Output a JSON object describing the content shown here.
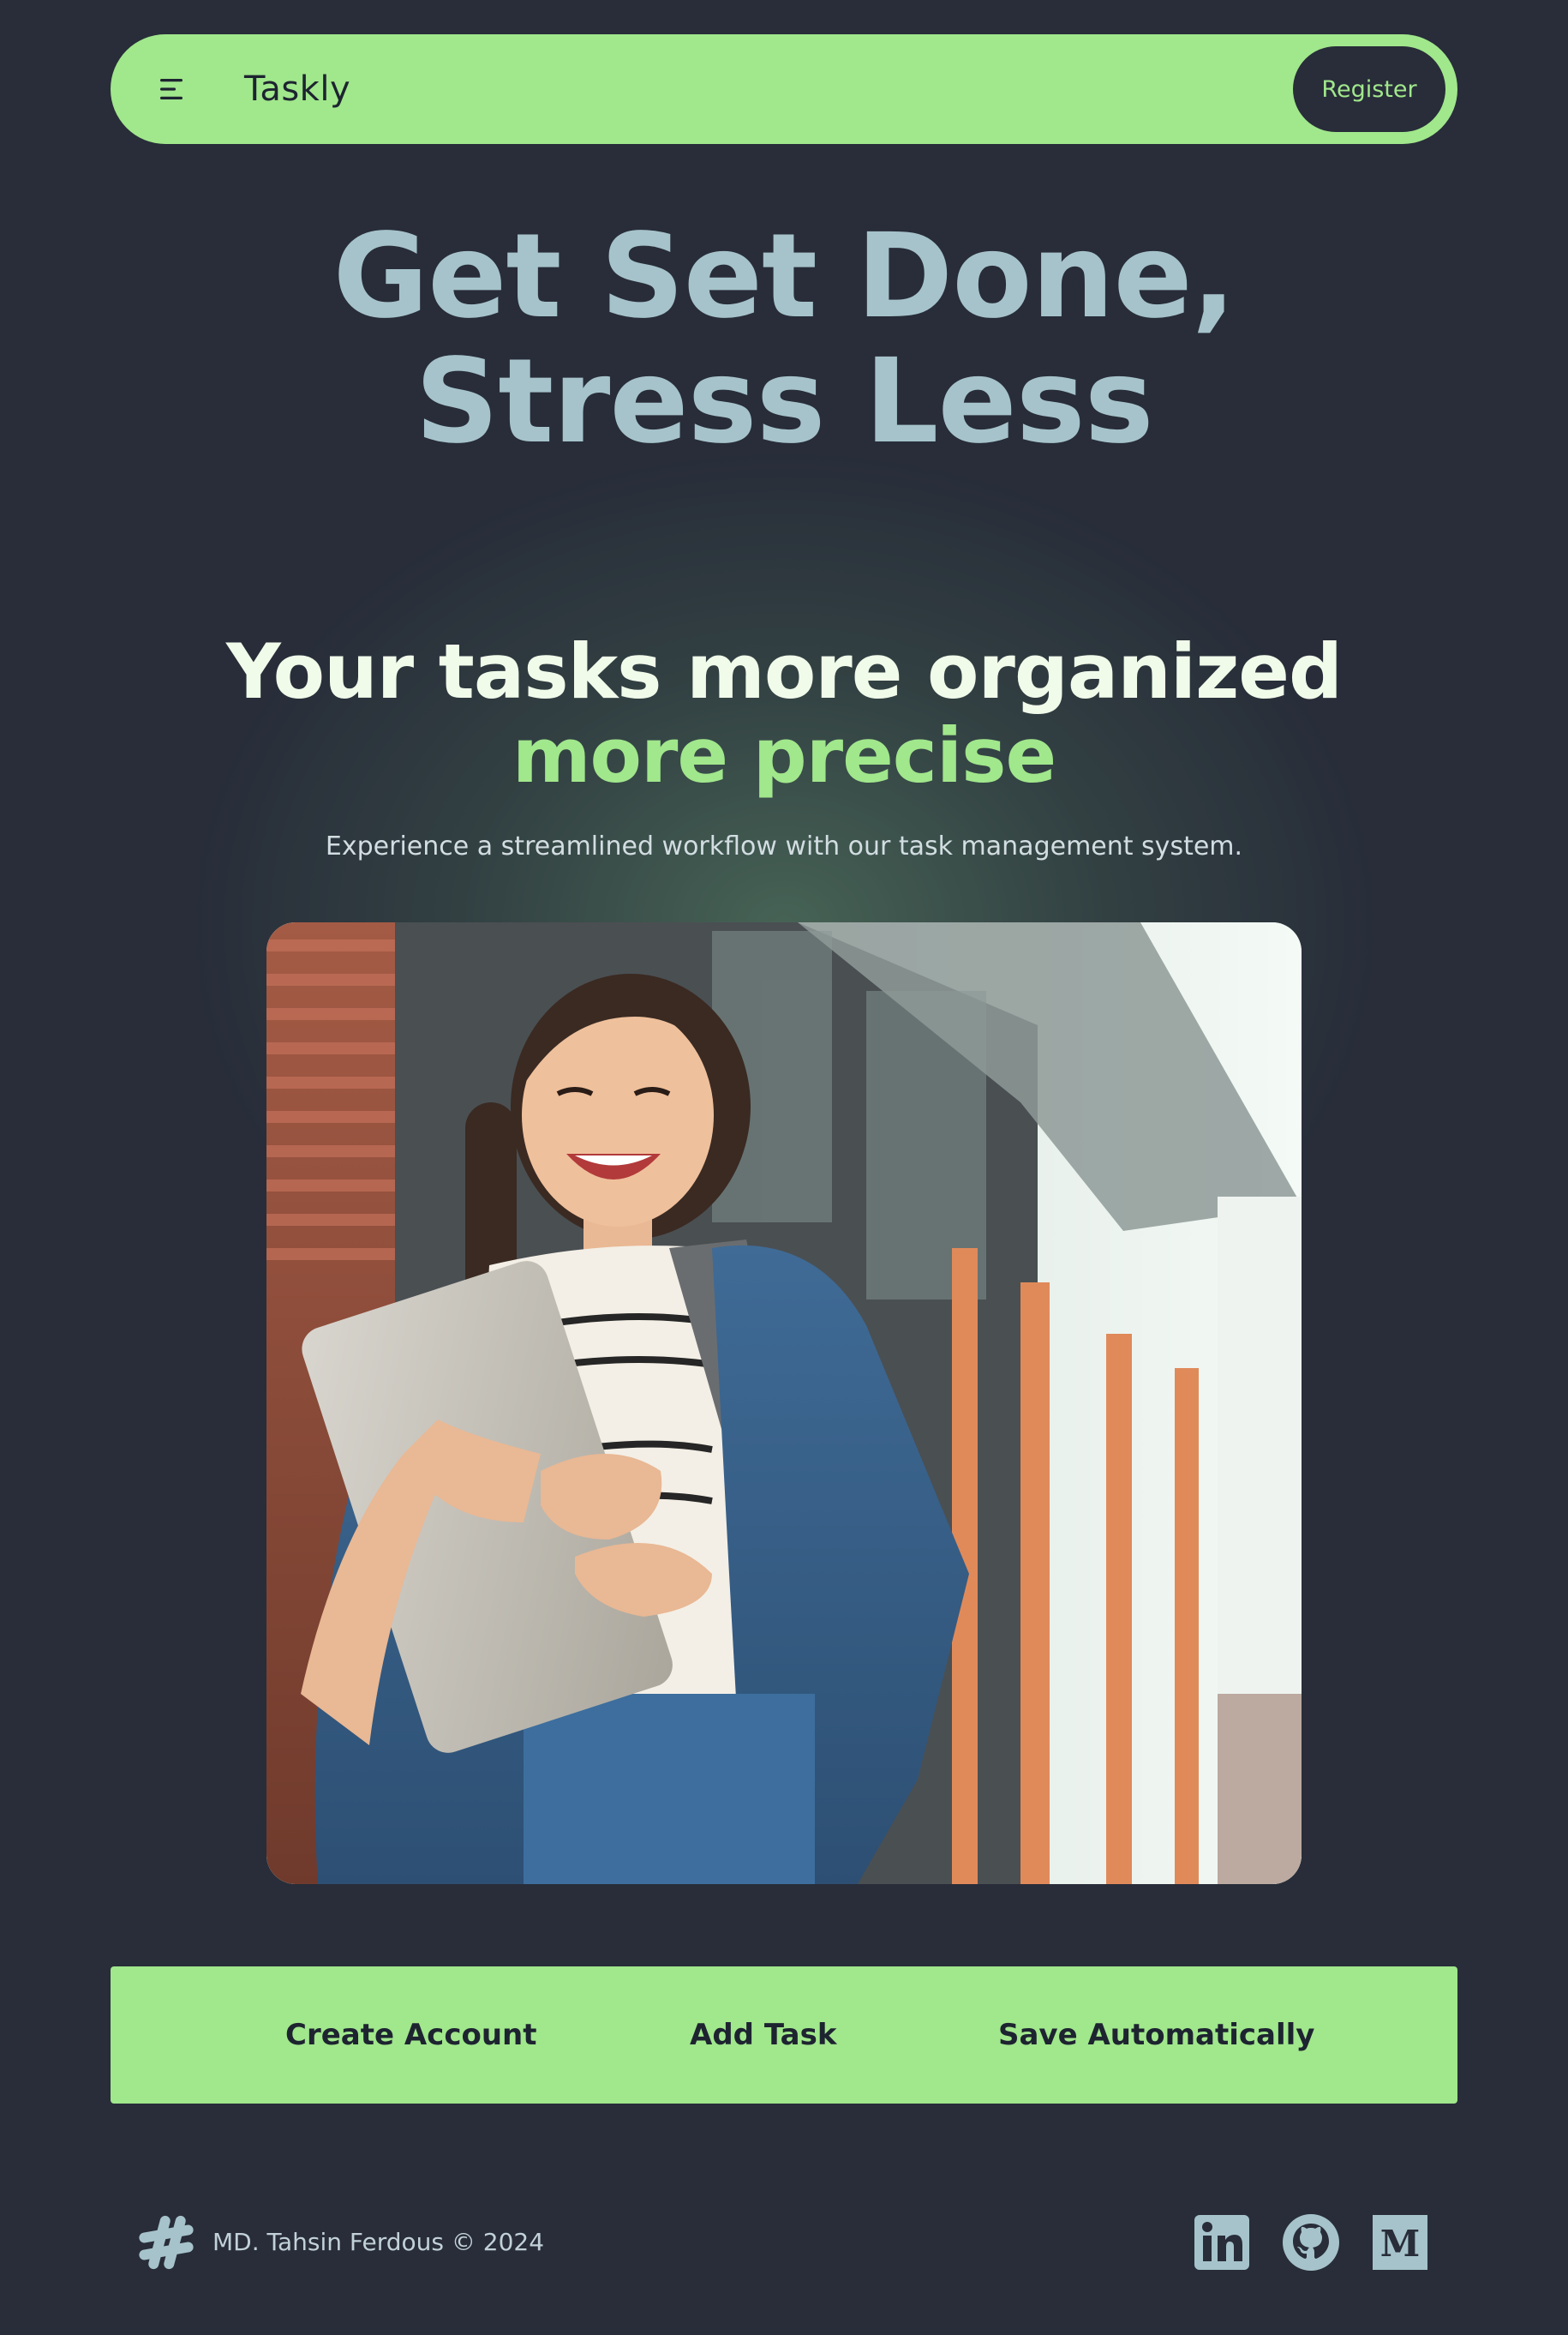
{
  "colors": {
    "background": "#282d39",
    "accent": "#a1e78c",
    "hero_title": "#a6c3cb",
    "text_light": "#f1fbea",
    "icon": "#a6c3cb"
  },
  "navbar": {
    "menu_icon": "hamburger-menu-icon",
    "brand": "Taskly",
    "register_label": "Register"
  },
  "hero": {
    "title": "Get Set Done,\nStress Less",
    "subtitle_line1": "Your tasks more organized",
    "subtitle_line2": "more precise",
    "description": "Experience a streamlined workflow with our task management system."
  },
  "features": {
    "items": [
      {
        "label": "Create Account"
      },
      {
        "label": "Add Task"
      },
      {
        "label": "Save Automatically"
      }
    ]
  },
  "footer": {
    "logo_icon": "hashtag-icon",
    "copyright": "MD. Tahsin Ferdous © 2024",
    "social": [
      {
        "icon": "linkedin-icon"
      },
      {
        "icon": "github-icon"
      },
      {
        "icon": "medium-icon"
      }
    ]
  }
}
